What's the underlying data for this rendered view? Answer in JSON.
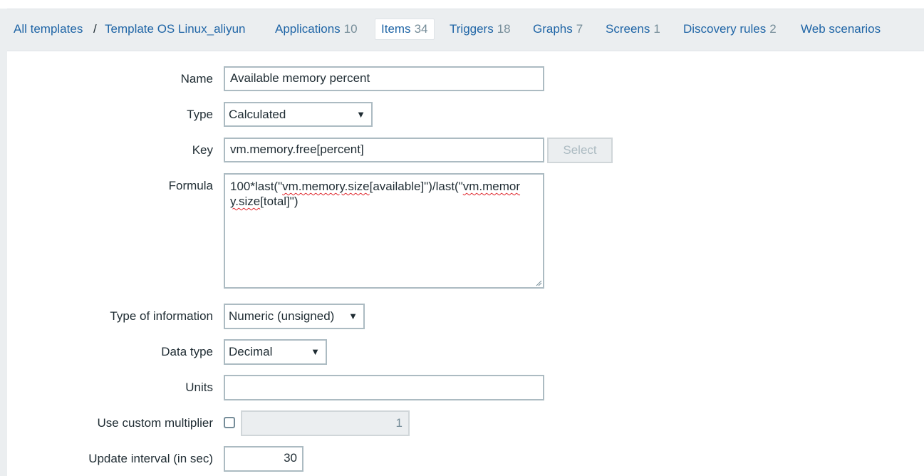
{
  "nav": {
    "all_templates": "All templates",
    "separator": "/",
    "template_name": "Template OS Linux_aliyun",
    "tabs": [
      {
        "label": "Applications",
        "count": "10"
      },
      {
        "label": "Items",
        "count": "34"
      },
      {
        "label": "Triggers",
        "count": "18"
      },
      {
        "label": "Graphs",
        "count": "7"
      },
      {
        "label": "Screens",
        "count": "1"
      },
      {
        "label": "Discovery rules",
        "count": "2"
      },
      {
        "label": "Web scenarios",
        "count": ""
      }
    ]
  },
  "form": {
    "name_label": "Name",
    "name_value": "Available memory percent",
    "type_label": "Type",
    "type_value": "Calculated",
    "key_label": "Key",
    "key_value": "vm.memory.free[percent]",
    "select_button": "Select",
    "formula_label": "Formula",
    "formula_part1": "100*last(\"",
    "formula_part2": "vm.memory.size",
    "formula_part3": "[available]\")/last(\"",
    "formula_part4": "vm.memor",
    "formula_part5": "y.size",
    "formula_part6": "[total]\")",
    "type_info_label": "Type of information",
    "type_info_value": "Numeric (unsigned)",
    "data_type_label": "Data type",
    "data_type_value": "Decimal",
    "units_label": "Units",
    "units_value": "",
    "multiplier_label": "Use custom multiplier",
    "multiplier_value": "1",
    "interval_label": "Update interval (in sec)",
    "interval_value": "30"
  },
  "icons": {
    "dropdown": "▼"
  },
  "colors": {
    "link": "#1f65a6",
    "count": "#768d99",
    "border": "#acbbc2",
    "background": "#ebeef0"
  }
}
